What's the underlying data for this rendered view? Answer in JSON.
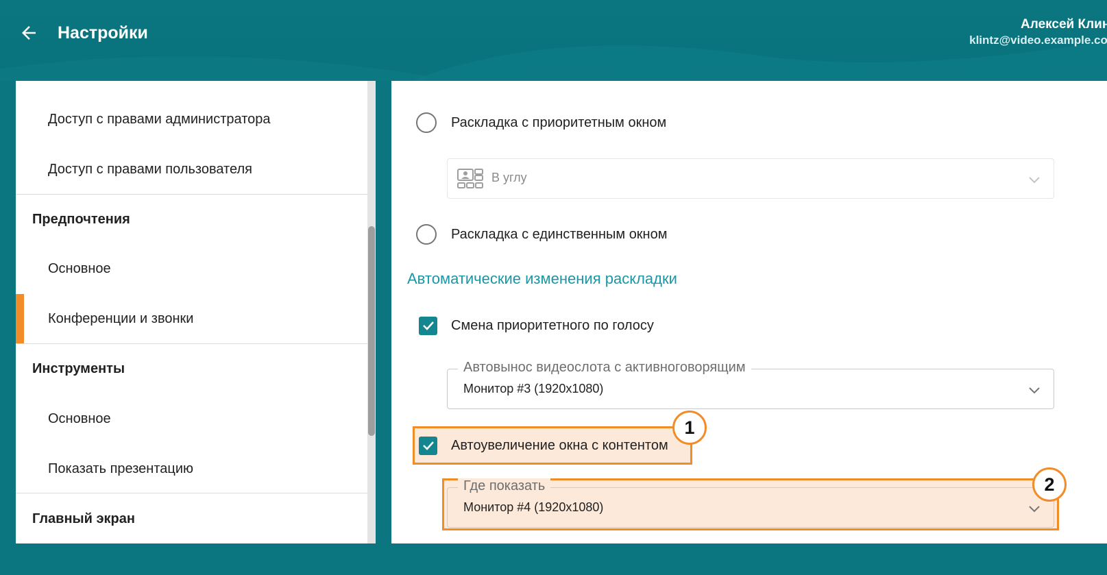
{
  "header": {
    "title": "Настройки",
    "user_name": "Алексей Клинц",
    "user_email": "klintz@video.example.com"
  },
  "sidebar": {
    "items": [
      {
        "label": "Доступ с правами администратора",
        "kind": "sub"
      },
      {
        "label": "Доступ с правами пользователя",
        "kind": "sub"
      },
      {
        "label": "Предпочтения",
        "kind": "group"
      },
      {
        "label": "Основное",
        "kind": "sub"
      },
      {
        "label": "Конференции и звонки",
        "kind": "sub",
        "active": true
      },
      {
        "label": "Инструменты",
        "kind": "group"
      },
      {
        "label": "Основное",
        "kind": "sub"
      },
      {
        "label": "Показать презентацию",
        "kind": "sub"
      },
      {
        "label": "Главный экран",
        "kind": "group"
      }
    ]
  },
  "main": {
    "radio_priority": {
      "label": "Раскладка с приоритетным окном",
      "checked": false
    },
    "priority_select": {
      "value": "В углу",
      "disabled": true
    },
    "radio_single": {
      "label": "Раскладка с единственным окном",
      "checked": false
    },
    "section_title": "Автоматические изменения раскладки",
    "check_voice": {
      "label": "Смена приоритетного по голосу",
      "checked": true
    },
    "speaker_select": {
      "legend": "Автовынос видеослота с активноговорящим",
      "value": "Монитор #3 (1920x1080)"
    },
    "check_content": {
      "label": "Автоувеличение окна с контентом",
      "checked": true
    },
    "where_select": {
      "legend": "Где показать",
      "value": "Монитор #4 (1920x1080)"
    }
  },
  "annotations": {
    "badge_1": "1",
    "badge_2": "2"
  },
  "colors": {
    "header_bg": "#0b7680",
    "accent": "#f28c28",
    "teal": "#138690",
    "section_title": "#1a97a5"
  }
}
